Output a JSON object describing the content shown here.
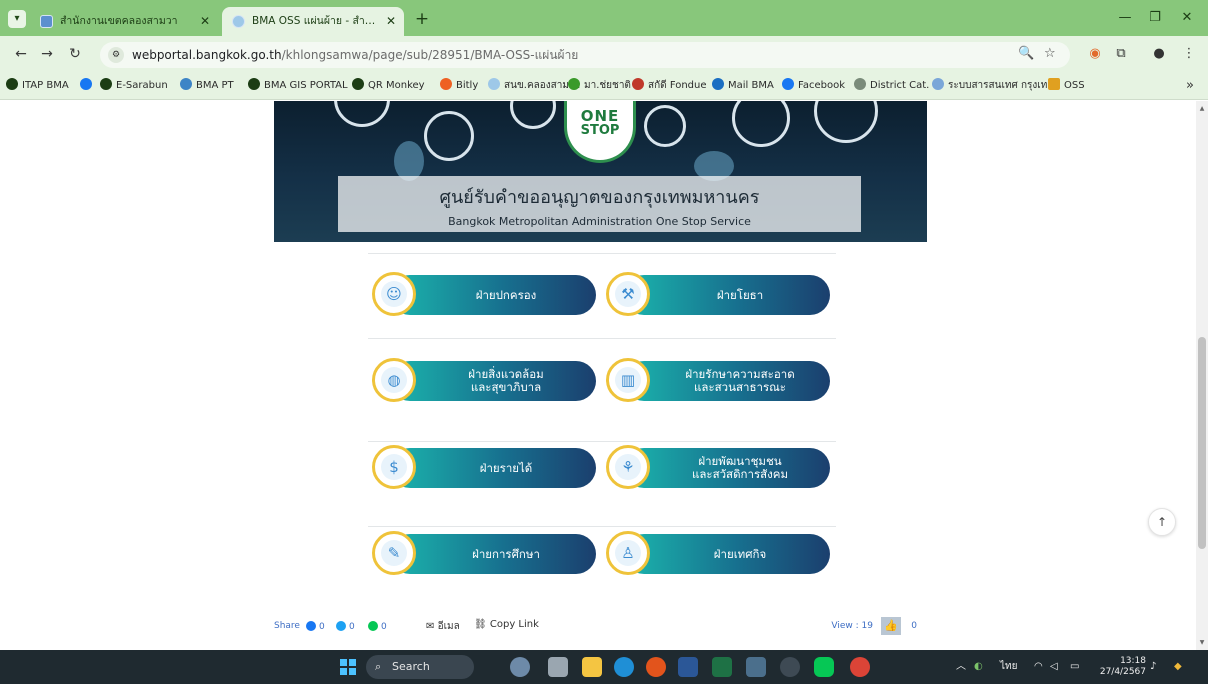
{
  "browser": {
    "tabs": [
      {
        "title": "สำนักงานเขตคลองสามวา",
        "active": false
      },
      {
        "title": "BMA OSS แผ่นผ้าย - สำนักงานเข",
        "active": true
      }
    ],
    "url_host": "webportal.bangkok.go.th",
    "url_path": "/khlongsamwa/page/sub/28951/BMA-OSS-แผ่นผ้าย",
    "bookmarks": [
      {
        "label": "ITAP BMA",
        "color": "#1c3d14"
      },
      {
        "label": "",
        "color": "#1877f2"
      },
      {
        "label": "E-Sarabun",
        "color": "#1c3d14"
      },
      {
        "label": "BMA PT",
        "color": "#3d84c6"
      },
      {
        "label": "BMA GIS PORTAL",
        "color": "#1c3d14"
      },
      {
        "label": "QR Monkey",
        "color": "#1c3d14"
      },
      {
        "label": "Bitly",
        "color": "#ee6123"
      },
      {
        "label": "สนข.คลองสามวา",
        "color": "#9ec8e8"
      },
      {
        "label": "มา.ช่ยชาติ",
        "color": "#3a9a2a"
      },
      {
        "label": "สกัดี Fondue",
        "color": "#c0392b"
      },
      {
        "label": "Mail BMA",
        "color": "#1b6ec2"
      },
      {
        "label": "Facebook",
        "color": "#1877f2"
      },
      {
        "label": "District Cat.",
        "color": "#7a8b7a"
      },
      {
        "label": "ระบบสารสนเทศ กรุงเท...",
        "color": "#7aa6d8"
      },
      {
        "label": "OSS",
        "color": "#e0a020"
      }
    ]
  },
  "banner": {
    "logo_line1": "ONE",
    "logo_line2": "STOP",
    "title_th": "ศูนย์รับคำขออนุญาตของกรุงเทพมหานคร",
    "title_en": "Bangkok Metropolitan Administration One Stop Service"
  },
  "departments": [
    {
      "label": "ฝ่ายปกครอง",
      "icon": "people-chart-icon"
    },
    {
      "label": "ฝ่ายโยธา",
      "icon": "construction-icon"
    },
    {
      "label": "ฝ่ายสิ่งแวดล้อม\nและสุขาภิบาล",
      "icon": "globe-icon"
    },
    {
      "label": "ฝ่ายรักษาความสะอาด\nและสวนสาธารณะ",
      "icon": "city-broom-icon"
    },
    {
      "label": "ฝ่ายรายได้",
      "icon": "money-growth-icon"
    },
    {
      "label": "ฝ่ายพัฒนาชุมชน\nและสวัสดิการสังคม",
      "icon": "community-icon"
    },
    {
      "label": "ฝ่ายการศึกษา",
      "icon": "education-icon"
    },
    {
      "label": "ฝ่ายเทศกิจ",
      "icon": "officer-icon"
    }
  ],
  "share": {
    "label": "Share",
    "facebook_count": "0",
    "twitter_count": "0",
    "line_count": "0",
    "email_label": "อีเมล",
    "copy_label": "Copy Link",
    "views": "View : 19",
    "likes": "0"
  },
  "taskbar": {
    "search_placeholder": "Search",
    "lang": "ไทย",
    "time": "13:18",
    "date": "27/4/2567"
  }
}
